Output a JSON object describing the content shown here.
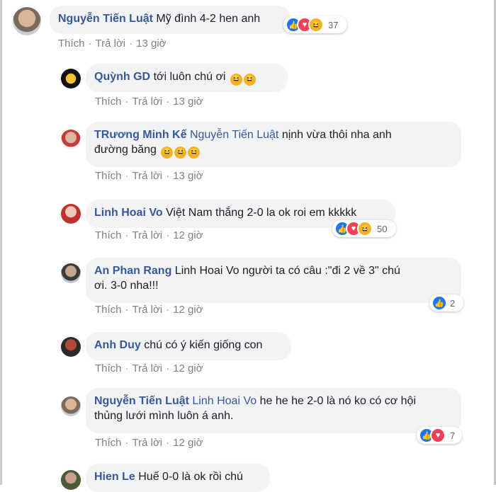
{
  "actions": {
    "like": "Thích",
    "reply": "Trả lời"
  },
  "comments": [
    {
      "author": "Nguyễn Tiến Luật",
      "text": "Mỹ đình 4-2 hen anh",
      "time": "13 giờ",
      "reactions_count": "37"
    },
    {
      "author": "Quỳnh GD",
      "text": "tới luôn chú ơi",
      "time": "13 giờ"
    },
    {
      "author": "TRương Minh Kế",
      "mention": "Nguyễn Tiến Luật",
      "text_line1": "nịnh vừa thôi nha anh",
      "text_line2": "đường băng",
      "time": "13 giờ"
    },
    {
      "author": "Linh Hoai Vo",
      "text": "Việt Nam thắng 2-0 la ok roi em kkkkk",
      "time": "12 giờ",
      "reactions_count": "50"
    },
    {
      "author": "An Phan Rang",
      "text_line1": "Linh Hoai Vo người ta có câu :\"đi 2 về 3\" chú",
      "text_line2": "ơi. 3-0 nha!!!",
      "time": "12 giờ",
      "reactions_count": "2"
    },
    {
      "author": "Anh Duy",
      "text": "chú có ý kiến giống con",
      "time": "12 giờ"
    },
    {
      "author": "Nguyễn Tiến Luật",
      "mention": "Linh Hoai Vo",
      "text_line1": "he he he 2-0 là nó ko có cơ hội",
      "text_line2": "thủng lưới mình luôn á anh.",
      "time": "12 giờ",
      "reactions_count": "7"
    },
    {
      "author": "Hien Le",
      "text": "Huế 0-0 là ok rồi chú"
    }
  ]
}
